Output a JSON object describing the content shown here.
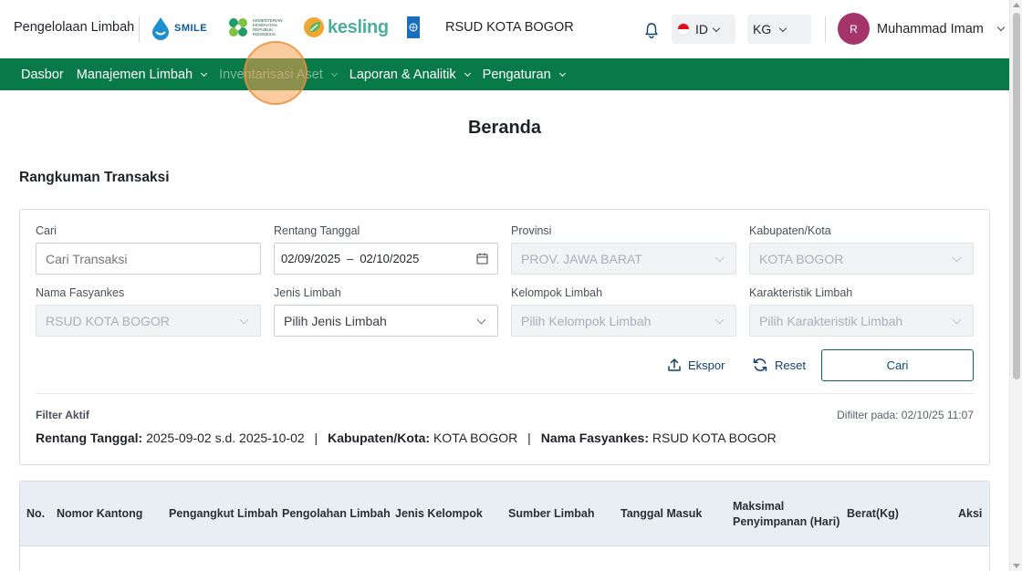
{
  "header": {
    "app_title": "Pengelolaan Limbah",
    "logos": {
      "smile": "SMILE",
      "kemenkes": "KEMENTERIAN KESEHATAN REPUBLIK INDONESIA",
      "kesling": "kesling",
      "undp": "UNDP"
    },
    "hospital": "RSUD KOTA BOGOR",
    "icons": [
      "bell-icon",
      "chevron-down-icon"
    ],
    "language": {
      "value": "ID",
      "flag_colors": [
        "#e30a17",
        "#ffffff"
      ]
    },
    "unit": {
      "value": "KG"
    },
    "user": {
      "initial": "R",
      "name": "Muhammad Imam",
      "avatar_color": "#a4346a"
    }
  },
  "nav": {
    "color": "#077a48",
    "items": [
      {
        "label": "Dasbor",
        "has_dropdown": false
      },
      {
        "label": "Manajemen Limbah",
        "has_dropdown": true
      },
      {
        "label": "Inventarisasi Aset",
        "has_dropdown": true
      },
      {
        "label": "Laporan & Analitik",
        "has_dropdown": true
      },
      {
        "label": "Pengaturan",
        "has_dropdown": true
      }
    ]
  },
  "page": {
    "title": "Beranda",
    "section_title": "Rangkuman Transaksi"
  },
  "filters": {
    "search": {
      "label": "Cari",
      "placeholder": "Cari Transaksi"
    },
    "date_range": {
      "label": "Rentang Tanggal",
      "start": "02/09/2025",
      "separator": "–",
      "end": "02/10/2025"
    },
    "province": {
      "label": "Provinsi",
      "value": "PROV. JAWA BARAT"
    },
    "city": {
      "label": "Kabupaten/Kota",
      "value": "KOTA BOGOR"
    },
    "facility": {
      "label": "Nama Fasyankes",
      "value": "RSUD KOTA BOGOR"
    },
    "waste_type": {
      "label": "Jenis Limbah",
      "placeholder": "Pilih Jenis Limbah"
    },
    "waste_group": {
      "label": "Kelompok Limbah",
      "placeholder": "Pilih Kelompok Limbah"
    },
    "waste_char": {
      "label": "Karakteristik Limbah",
      "placeholder": "Pilih Karakteristik Limbah"
    },
    "actions": {
      "export": "Ekspor",
      "reset": "Reset",
      "search": "Cari"
    }
  },
  "active_filters": {
    "title": "Filter Aktif",
    "filtered_at": "Difilter pada: 02/10/25 11:07",
    "date_label": "Rentang Tanggal:",
    "date_value": "2025-09-02 s.d. 2025-10-02",
    "city_label": "Kabupaten/Kota:",
    "city_value": "KOTA BOGOR",
    "facility_label": "Nama Fasyankes:",
    "facility_value": "RSUD KOTA BOGOR",
    "separator": "|"
  },
  "table": {
    "columns": [
      "No.",
      "Nomor Kantong",
      "Pengangkut Limbah",
      "Pengolahan Limbah",
      "Jenis Kelompok",
      "Sumber Limbah",
      "Tanggal Masuk",
      "Maksimal Penyimpanan (Hari)",
      "Berat(Kg)",
      "Aksi"
    ]
  }
}
